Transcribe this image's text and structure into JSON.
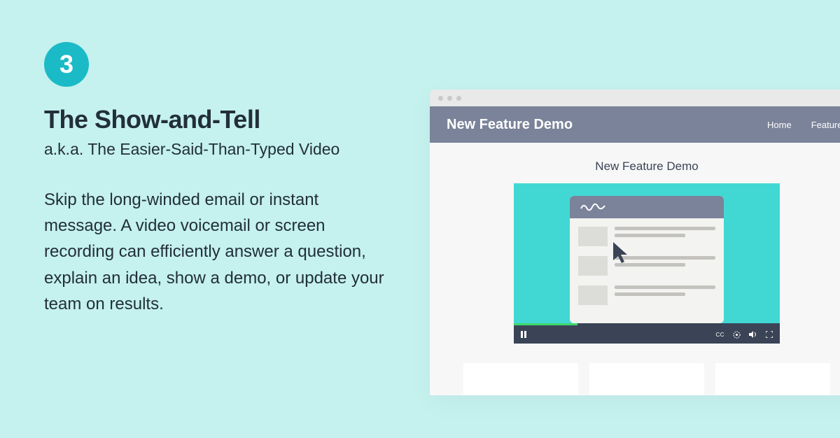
{
  "badge": {
    "number": "3"
  },
  "title": "The Show-and-Tell",
  "subtitle": "a.k.a. The Easier-Said-Than-Typed Video",
  "body": "Skip the long-winded email or instant message. A video voicemail or screen recording can efficiently answer a question, explain an idea, show a demo, or update your team on results.",
  "mockup": {
    "header_title": "New Feature Demo",
    "nav": {
      "home": "Home",
      "features": "Features"
    },
    "page_heading": "New Feature Demo",
    "controls": {
      "cc": "CC"
    }
  }
}
